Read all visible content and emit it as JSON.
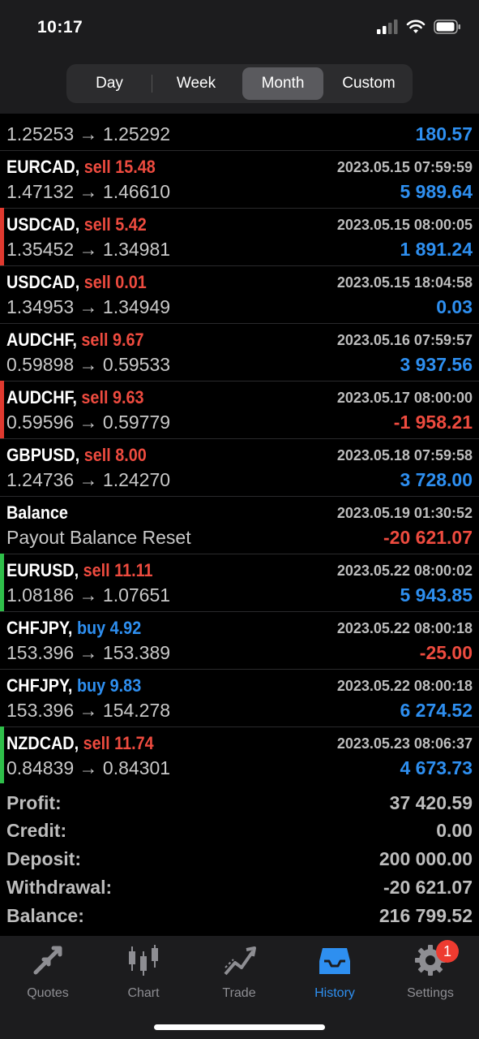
{
  "status_bar": {
    "time": "10:17"
  },
  "period_tabs": [
    {
      "label": "Day",
      "active": false
    },
    {
      "label": "Week",
      "active": false
    },
    {
      "label": "Month",
      "active": true
    },
    {
      "label": "Custom",
      "active": false
    }
  ],
  "partial_row": {
    "prices": "1.25253 → 1.25292",
    "amount": "180.57"
  },
  "rows": [
    {
      "symbol": "EURCAD,",
      "side": "sell",
      "volume": "15.48",
      "datetime": "2023.05.15 07:59:59",
      "prices": "1.47132 → 1.46610",
      "amount": "5 989.64",
      "amount_sign": "pos",
      "marker": ""
    },
    {
      "symbol": "USDCAD,",
      "side": "sell",
      "volume": "5.42",
      "datetime": "2023.05.15 08:00:05",
      "prices": "1.35452 → 1.34981",
      "amount": "1 891.24",
      "amount_sign": "pos",
      "marker": "#e0392f"
    },
    {
      "symbol": "USDCAD,",
      "side": "sell",
      "volume": "0.01",
      "datetime": "2023.05.15 18:04:58",
      "prices": "1.34953 → 1.34949",
      "amount": "0.03",
      "amount_sign": "pos",
      "marker": ""
    },
    {
      "symbol": "AUDCHF,",
      "side": "sell",
      "volume": "9.67",
      "datetime": "2023.05.16 07:59:57",
      "prices": "0.59898 → 0.59533",
      "amount": "3 937.56",
      "amount_sign": "pos",
      "marker": ""
    },
    {
      "symbol": "AUDCHF,",
      "side": "sell",
      "volume": "9.63",
      "datetime": "2023.05.17 08:00:00",
      "prices": "0.59596 → 0.59779",
      "amount": "-1 958.21",
      "amount_sign": "neg",
      "marker": "#e0392f"
    },
    {
      "symbol": "GBPUSD,",
      "side": "sell",
      "volume": "8.00",
      "datetime": "2023.05.18 07:59:58",
      "prices": "1.24736 → 1.24270",
      "amount": "3 728.00",
      "amount_sign": "pos",
      "marker": ""
    },
    {
      "symbol": "Balance",
      "side": "",
      "volume": "",
      "datetime": "2023.05.19 01:30:52",
      "prices": "Payout Balance Reset",
      "amount": "-20 621.07",
      "amount_sign": "neg",
      "marker": ""
    },
    {
      "symbol": "EURUSD,",
      "side": "sell",
      "volume": "11.11",
      "datetime": "2023.05.22 08:00:02",
      "prices": "1.08186 → 1.07651",
      "amount": "5 943.85",
      "amount_sign": "pos",
      "marker": "#2fbf4a"
    },
    {
      "symbol": "CHFJPY,",
      "side": "buy",
      "volume": "4.92",
      "datetime": "2023.05.22 08:00:18",
      "prices": "153.396 → 153.389",
      "amount": "-25.00",
      "amount_sign": "neg",
      "marker": ""
    },
    {
      "symbol": "CHFJPY,",
      "side": "buy",
      "volume": "9.83",
      "datetime": "2023.05.22 08:00:18",
      "prices": "153.396 → 154.278",
      "amount": "6 274.52",
      "amount_sign": "pos",
      "marker": ""
    },
    {
      "symbol": "NZDCAD,",
      "side": "sell",
      "volume": "11.74",
      "datetime": "2023.05.23 08:06:37",
      "prices": "0.84839 → 0.84301",
      "amount": "4 673.73",
      "amount_sign": "pos",
      "marker": "#2fbf4a"
    }
  ],
  "summary": [
    {
      "key": "Profit:",
      "value": "37 420.59"
    },
    {
      "key": "Credit:",
      "value": "0.00"
    },
    {
      "key": "Deposit:",
      "value": "200 000.00"
    },
    {
      "key": "Withdrawal:",
      "value": "-20 621.07"
    },
    {
      "key": "Balance:",
      "value": "216 799.52"
    }
  ],
  "tabbar": [
    {
      "label": "Quotes",
      "icon": "quotes-arrows-icon",
      "active": false
    },
    {
      "label": "Chart",
      "icon": "candlestick-chart-icon",
      "active": false
    },
    {
      "label": "Trade",
      "icon": "trend-line-icon",
      "active": false
    },
    {
      "label": "History",
      "icon": "inbox-tray-icon",
      "active": true
    },
    {
      "label": "Settings",
      "icon": "gear-icon",
      "active": false,
      "badge": "1"
    }
  ],
  "colors": {
    "sell": "#ee4b3f",
    "buy": "#2e8ff0",
    "profit": "#2e8ff0",
    "loss": "#ee4b3f",
    "active_tab": "#2e8ff0"
  }
}
